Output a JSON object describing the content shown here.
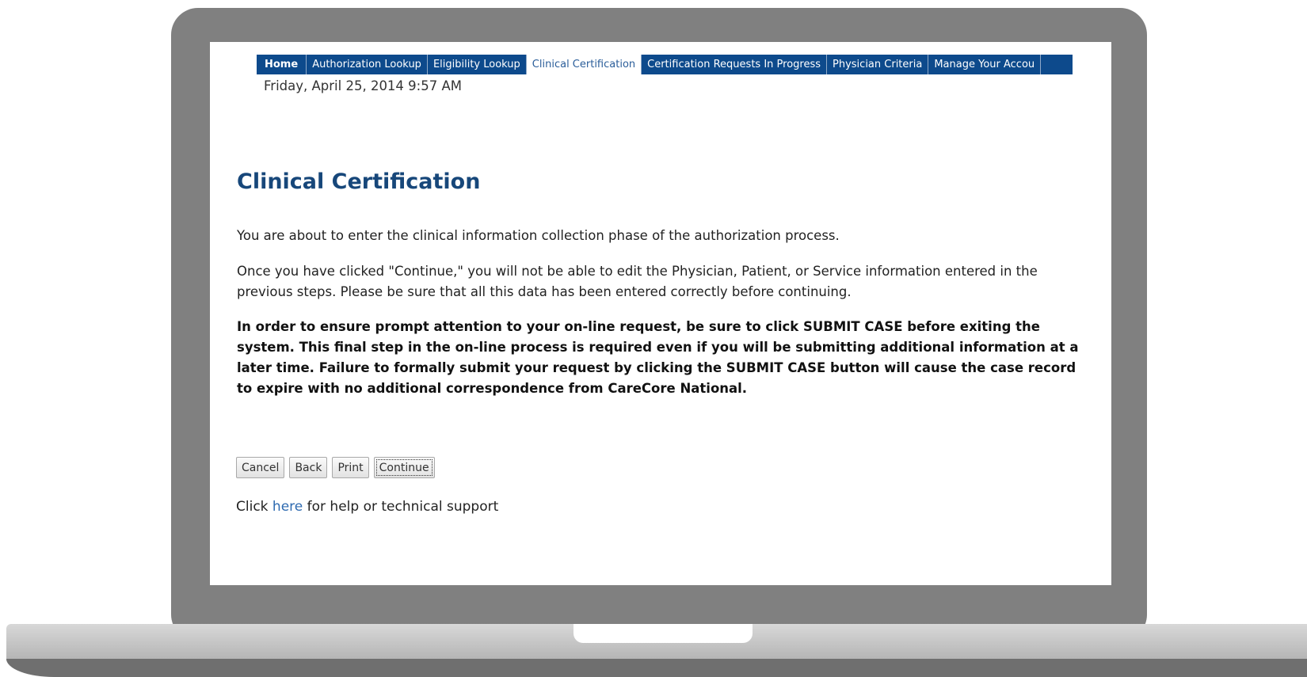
{
  "nav": {
    "items": [
      {
        "label": "Home"
      },
      {
        "label": "Authorization Lookup"
      },
      {
        "label": "Eligibility Lookup"
      },
      {
        "label": "Clinical Certification"
      },
      {
        "label": "Certification Requests In Progress"
      },
      {
        "label": "Physician Criteria"
      },
      {
        "label": "Manage Your Accou"
      }
    ],
    "active": "Clinical Certification"
  },
  "date": "Friday, April 25, 2014 9:57 AM",
  "page_title": "Clinical Certification",
  "paragraphs": {
    "intro": "You are about to enter the clinical information collection phase of the authorization process.",
    "warning": "Once you have clicked \"Continue,\" you will not be able to edit the Physician, Patient, or Service information entered in the previous steps. Please be sure that all this data has been entered correctly before continuing.",
    "notice": "In order to ensure prompt attention to your on-line request, be sure to click SUBMIT CASE before exiting the system. This final step in the on-line process is required even if you will be submitting additional information at a later time. Failure to formally submit your request by clicking the SUBMIT CASE button will cause the case record to expire with no additional correspondence from CareCore National."
  },
  "buttons": {
    "cancel": "Cancel",
    "back": "Back",
    "print": "Print",
    "continue": "Continue"
  },
  "help": {
    "prefix": "Click ",
    "link": "here",
    "suffix": " for help or technical support"
  },
  "colors": {
    "nav_bg": "#0d4a8c",
    "title": "#17477a",
    "link": "#2e6ab0",
    "laptop_frame": "#808080"
  }
}
